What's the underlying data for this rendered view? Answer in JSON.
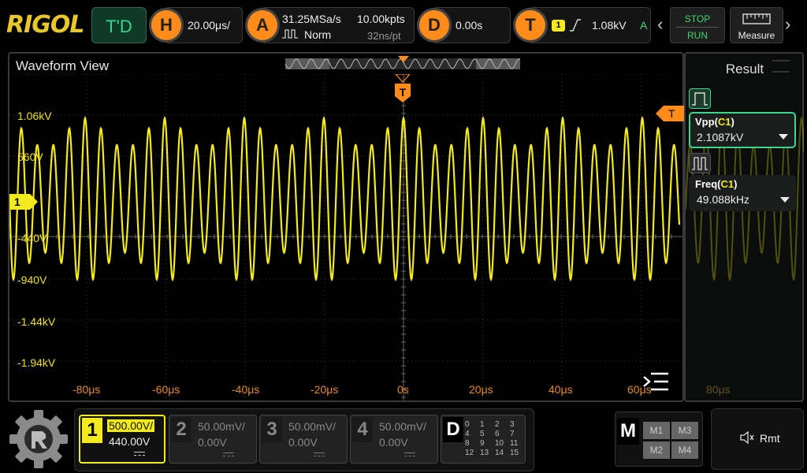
{
  "brand": "RIGOL",
  "top": {
    "td_label": "T'D",
    "horizontal": {
      "badge": "H",
      "timebase": "20.00μs/"
    },
    "acquire": {
      "badge": "A",
      "sample_rate": "31.25MSa/s",
      "mode": "Norm",
      "mem_depth": "10.00kpts",
      "time_per_point": "32ns/pt"
    },
    "delay": {
      "badge": "D",
      "value": "0.00s"
    },
    "trigger": {
      "badge": "T",
      "source": "1",
      "level": "1.08kV",
      "sweep": "A"
    },
    "stop_label": "STOP",
    "run_label": "RUN",
    "measure_label": "Measure"
  },
  "waveform_view": {
    "title": "Waveform View",
    "trigger_marker": "T",
    "channel_marker": "1",
    "y_labels": [
      "1.06kV",
      "560V",
      "-440V",
      "-940V",
      "-1.44kV",
      "-1.94kV"
    ],
    "x_labels": [
      "-80μs",
      "-60μs",
      "-40μs",
      "-20μs",
      "0s",
      "20μs",
      "40μs",
      "60μs",
      "80μs"
    ],
    "channel_color": "#f2ea1c"
  },
  "result_panel": {
    "title": "Result",
    "items": [
      {
        "name": "Vpp",
        "channel": "C1",
        "value": "2.1087kV"
      },
      {
        "name": "Freq",
        "channel": "C1",
        "value": "49.088kHz"
      }
    ]
  },
  "channels": [
    {
      "num": "1",
      "scale": "500.00V/",
      "offset": "440.00V",
      "active": true
    },
    {
      "num": "2",
      "scale": "50.00mV/",
      "offset": "0.00V",
      "active": false
    },
    {
      "num": "3",
      "scale": "50.00mV/",
      "offset": "0.00V",
      "active": false
    },
    {
      "num": "4",
      "scale": "50.00mV/",
      "offset": "0.00V",
      "active": false
    }
  ],
  "digital": {
    "label": "D",
    "grid": [
      "0",
      "1",
      "2",
      "3",
      "4",
      "5",
      "6",
      "7",
      "8",
      "9",
      "10",
      "11",
      "12",
      "13",
      "14",
      "15"
    ]
  },
  "math": {
    "label": "M",
    "buttons": [
      "M1",
      "M3",
      "M2",
      "M4"
    ]
  },
  "remote_label": "Rmt"
}
